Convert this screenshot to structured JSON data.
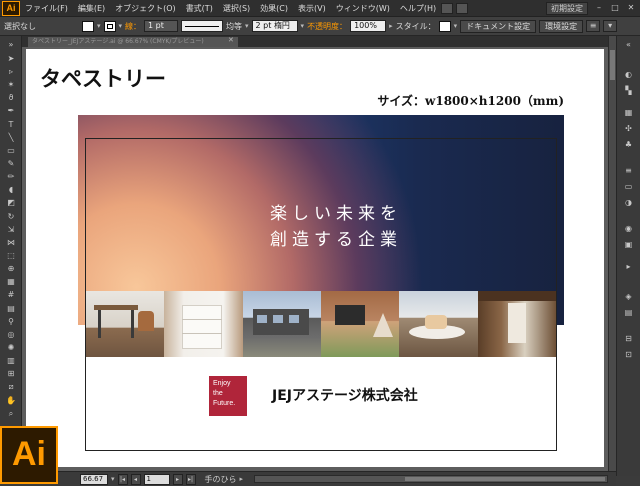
{
  "app": {
    "logo": "Ai",
    "badge": "Ai"
  },
  "menu": {
    "items": [
      "ファイル(F)",
      "編集(E)",
      "オブジェクト(O)",
      "書式(T)",
      "選択(S)",
      "効果(C)",
      "表示(V)",
      "ウィンドウ(W)",
      "ヘルプ(H)"
    ],
    "workspace": "初期設定"
  },
  "control": {
    "selection": "選択なし",
    "stroke_label": "線：",
    "stroke_weight": "1 pt",
    "profile": "均等",
    "brush": "2 pt 楕円",
    "opacity_label": "不透明度：",
    "opacity_value": "100%",
    "style_label": "スタイル：",
    "doc_setup": "ドキュメント設定",
    "preferences": "環境設定"
  },
  "document": {
    "tab_title": "タペストリー_JEJアステージ.ai @ 66.67% (CMYK/プレビュー)"
  },
  "artboard": {
    "title": "タペストリー",
    "size": "サイズ：w1800×h1200（mm)",
    "headline_line1": "楽しい未来を",
    "headline_line2": "創造する企業",
    "logo_line1": "Enjoy",
    "logo_line2": "the",
    "logo_line3": "Future.",
    "company": "JEJアステージ株式会社"
  },
  "status": {
    "zoom": "66.67",
    "page": "1",
    "tool": "手のひら"
  },
  "colors": {
    "accent": "#ff9a00",
    "logo_red": "#b0253a",
    "navy": "#1a2a50"
  }
}
